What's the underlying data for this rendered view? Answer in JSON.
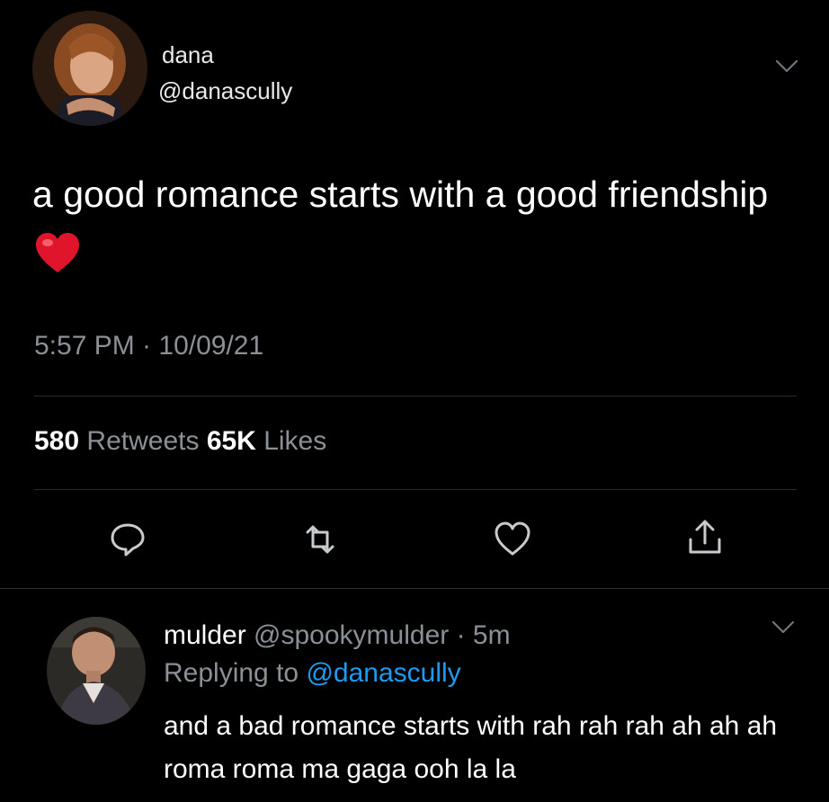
{
  "tweet": {
    "author": {
      "display_name": "dana",
      "handle": "@danascully",
      "avatar_icon": "avatar-photo-woman"
    },
    "text": "a good romance starts with a good friendship",
    "emoji": "red-heart",
    "timestamp": "5:57 PM · 10/09/21",
    "stats": {
      "retweets_count": "580",
      "retweets_label": "Retweets",
      "likes_count": "65K",
      "likes_label": "Likes"
    },
    "actions": {
      "reply_icon": "reply-icon",
      "retweet_icon": "retweet-icon",
      "like_icon": "heart-icon",
      "share_icon": "share-icon"
    }
  },
  "reply": {
    "display_name": "mulder",
    "handle": "@spookymulder",
    "time": "· 5m",
    "replying_prefix": "Replying to",
    "replying_to": "@danascully",
    "text": "and a bad romance starts with rah rah rah ah ah ah roma roma ma gaga ooh la la",
    "avatar_icon": "avatar-photo-man"
  },
  "colors": {
    "background": "#000000",
    "primary_text": "#ffffff",
    "secondary_text": "#8b9096",
    "link": "#1d9bf0",
    "heart": "#e0245e"
  }
}
